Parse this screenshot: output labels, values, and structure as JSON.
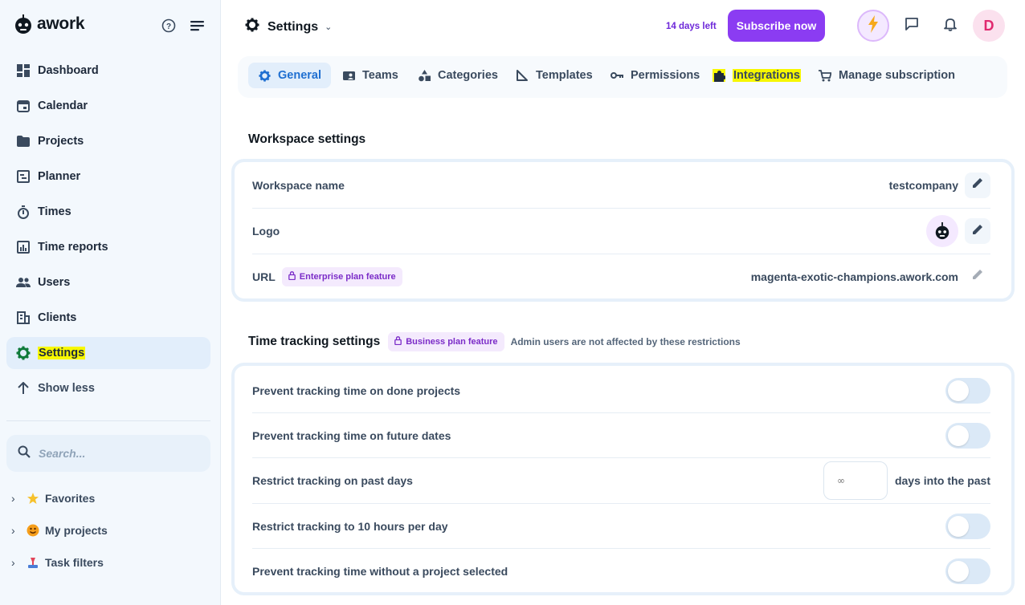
{
  "brand": {
    "name": "awork"
  },
  "sidebar": {
    "items": [
      {
        "label": "Dashboard",
        "icon": "dashboard-icon"
      },
      {
        "label": "Calendar",
        "icon": "calendar-icon"
      },
      {
        "label": "Projects",
        "icon": "folder-icon"
      },
      {
        "label": "Planner",
        "icon": "planner-icon"
      },
      {
        "label": "Times",
        "icon": "stopwatch-icon"
      },
      {
        "label": "Time reports",
        "icon": "report-icon"
      },
      {
        "label": "Users",
        "icon": "users-icon"
      },
      {
        "label": "Clients",
        "icon": "building-icon"
      },
      {
        "label": "Settings",
        "icon": "gear-icon",
        "active": true
      },
      {
        "label": "Show less",
        "icon": "arrow-up-icon"
      }
    ],
    "search": {
      "placeholder": "Search..."
    },
    "groups": [
      {
        "label": "Favorites",
        "icon": "star-icon"
      },
      {
        "label": "My projects",
        "icon": "smiley-icon"
      },
      {
        "label": "Task filters",
        "icon": "filter-icon"
      }
    ]
  },
  "header": {
    "title": "Settings",
    "days_left": "14 days left",
    "subscribe_label": "Subscribe now",
    "avatar_initial": "D"
  },
  "tabs": [
    {
      "label": "General",
      "active": true
    },
    {
      "label": "Teams"
    },
    {
      "label": "Categories"
    },
    {
      "label": "Templates"
    },
    {
      "label": "Permissions"
    },
    {
      "label": "Integrations"
    },
    {
      "label": "Manage subscription"
    }
  ],
  "workspace": {
    "title": "Workspace settings",
    "name_label": "Workspace name",
    "name_value": "testcompany",
    "logo_label": "Logo",
    "url_label": "URL",
    "url_badge": "Enterprise plan feature",
    "url_value": "magenta-exotic-champions.awork.com"
  },
  "time_tracking": {
    "title": "Time tracking settings",
    "badge": "Business plan feature",
    "note": "Admin users are not affected by these restrictions",
    "rows": [
      {
        "label": "Prevent tracking time on done projects",
        "enabled": false
      },
      {
        "label": "Prevent tracking time on future dates",
        "enabled": false
      },
      {
        "label": "Restrict tracking on past days",
        "input_placeholder": "∞",
        "suffix": "days into the past"
      },
      {
        "label": "Restrict tracking to 10 hours per day",
        "enabled": false
      },
      {
        "label": "Prevent tracking time without a project selected",
        "enabled": false
      }
    ]
  },
  "colors": {
    "accent": "#8b3cf2",
    "active_tab": "#1f6fd1",
    "highlight": "#f7f700"
  }
}
